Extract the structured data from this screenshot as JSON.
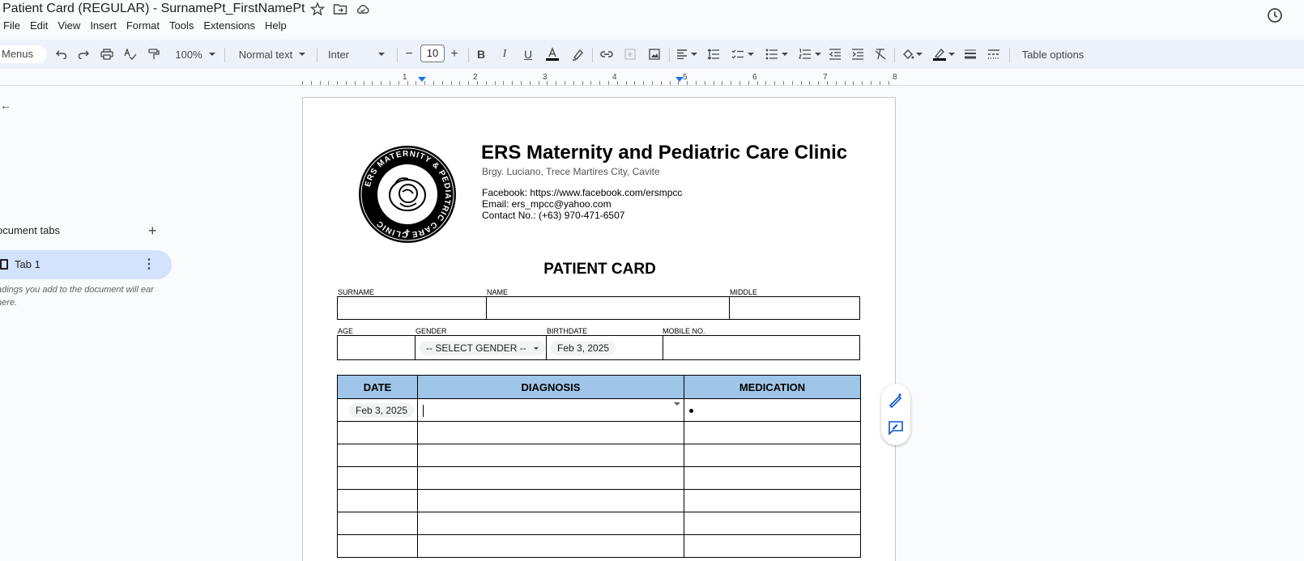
{
  "window": {
    "doc_title": "Patient Card (REGULAR) - SurnamePt_FirstNamePt"
  },
  "title_icons": [
    "star-icon",
    "move-to-folder-icon",
    "cloud-status-icon"
  ],
  "history_icon": "version-history-icon",
  "menubar": [
    "File",
    "Edit",
    "View",
    "Insert",
    "Format",
    "Tools",
    "Extensions",
    "Help"
  ],
  "toolbar": {
    "menus_label": "Menus",
    "zoom": "100%",
    "style": "Normal text",
    "font": "Inter",
    "font_size": "10",
    "minus": "−",
    "plus": "+",
    "table_options": "Table options"
  },
  "ruler": {
    "numbers": [
      "1",
      "2",
      "3",
      "4",
      "5",
      "6",
      "7",
      "8"
    ]
  },
  "sidebar": {
    "back": "←",
    "heading": "ocument tabs",
    "tab_label": "Tab 1",
    "note": "adings you add to the document will ear here."
  },
  "document": {
    "clinic_name": "ERS Maternity and Pediatric Care Clinic",
    "address": "Brgy. Luciano, Trece Martires City, Cavite",
    "facebook": "Facebook: https://www.facebook.com/ersmpcc",
    "email": "Email: ers_mpcc@yahoo.com",
    "contact": "Contact No.: (+63) 970-471-6507",
    "logo_text": "ERS MATERNITY & PEDIATRIC CARE CLINIC",
    "card_title": "PATIENT CARD",
    "labels": {
      "surname": "SURNAME",
      "name": "NAME",
      "middle": "MIDDLE",
      "age": "AGE",
      "gender": "GENDER",
      "birthdate": "BIRTHDATE",
      "mobile": "MOBILE NO."
    },
    "gender_select": "-- SELECT GENDER --",
    "birthdate_value": "Feb 3, 2025",
    "table": {
      "headers": [
        "DATE",
        "DIAGNOSIS",
        "MEDICATION"
      ],
      "first_date": "Feb 3, 2025"
    }
  }
}
